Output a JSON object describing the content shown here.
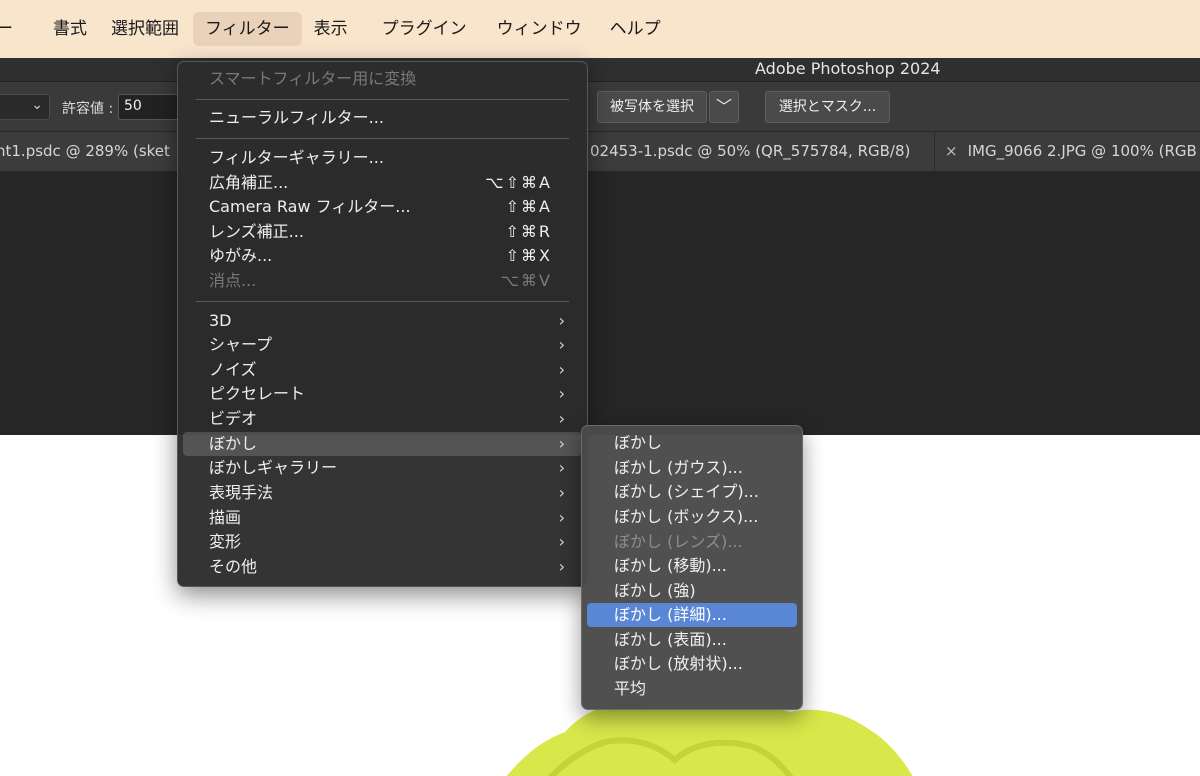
{
  "menubar": {
    "items": [
      "ー",
      "書式",
      "選択範囲",
      "フィルター",
      "表示",
      "プラグイン",
      "ウィンドウ",
      "ヘルプ"
    ],
    "active": "フィルター"
  },
  "app_title": "Adobe Photoshop 2024",
  "options": {
    "tolerance_label": "許容値 :",
    "tolerance_value": "50",
    "select_subject": "被写体を選択",
    "dropdown_glyph": "﹀",
    "select_and_mask": "選択とマスク..."
  },
  "tabs": [
    {
      "label": "nt1.psdc @ 289% (sket"
    },
    {
      "label": "02453-1.psdc @ 50% (QR_575784, RGB/8)"
    },
    {
      "label": "IMG_9066 2.JPG @ 100% (RGB"
    }
  ],
  "tab_close_glyph": "×",
  "filter_menu": {
    "smart_filter": "スマートフィルター用に変換",
    "neural": "ニューラルフィルター...",
    "gallery": "フィルターギャラリー...",
    "wide_angle": {
      "label": "広角補正...",
      "shortcut": "⌥⇧⌘A"
    },
    "camera_raw": {
      "label": "Camera Raw フィルター...",
      "shortcut": "⇧⌘A"
    },
    "lens": {
      "label": "レンズ補正...",
      "shortcut": "⇧⌘R"
    },
    "liquify": {
      "label": "ゆがみ...",
      "shortcut": "⇧⌘X"
    },
    "vanishing": {
      "label": "消点...",
      "shortcut": "⌥⌘V"
    },
    "submenus": [
      "3D",
      "シャープ",
      "ノイズ",
      "ピクセレート",
      "ビデオ",
      "ぼかし",
      "ぼかしギャラリー",
      "表現手法",
      "描画",
      "変形",
      "その他"
    ],
    "arrow": "›"
  },
  "blur_submenu": [
    {
      "label": "ぼかし"
    },
    {
      "label": "ぼかし (ガウス)..."
    },
    {
      "label": "ぼかし (シェイプ)..."
    },
    {
      "label": "ぼかし (ボックス)..."
    },
    {
      "label": "ぼかし (レンズ)..."
    },
    {
      "label": "ぼかし (移動)..."
    },
    {
      "label": "ぼかし (強)"
    },
    {
      "label": "ぼかし (詳細)..."
    },
    {
      "label": "ぼかし (表面)..."
    },
    {
      "label": "ぼかし (放射状)..."
    },
    {
      "label": "平均"
    }
  ],
  "colors": {
    "menubar_bg": "#f9e4cc",
    "selected_item": "#5a86d6",
    "canvas_shape": "#d8e84a"
  }
}
